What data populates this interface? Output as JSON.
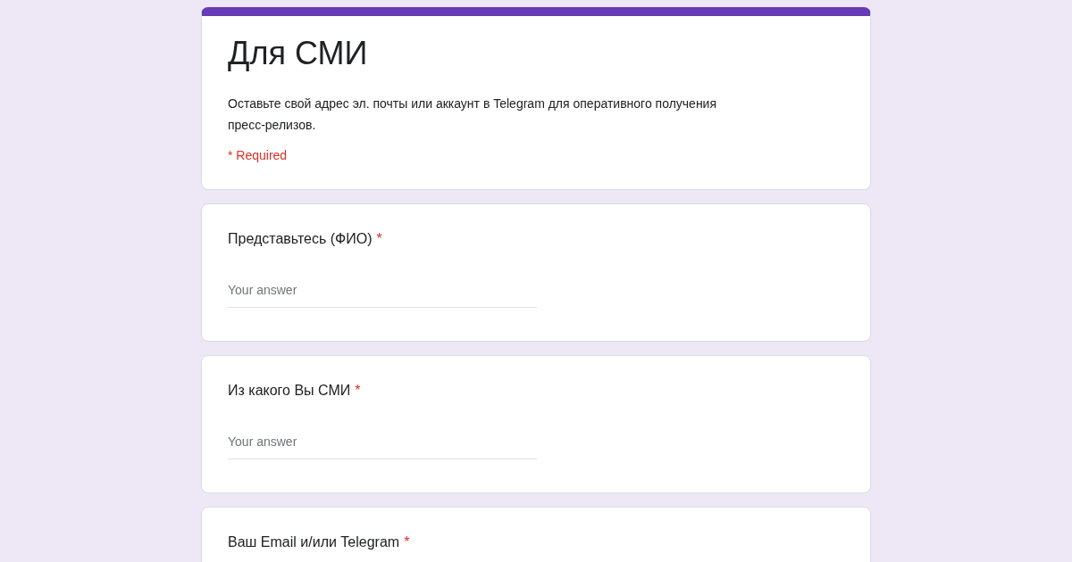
{
  "form": {
    "title": "Для СМИ",
    "description": "Оставьте свой адрес эл. почты или аккаунт в Telegram для оперативного получения пресс-релизов.",
    "required_note": "* Required"
  },
  "questions": [
    {
      "label": "Представьтесь (ФИО)",
      "required_mark": "*",
      "placeholder": "Your answer"
    },
    {
      "label": "Из какого Вы СМИ",
      "required_mark": "*",
      "placeholder": "Your answer"
    },
    {
      "label": "Ваш Email и/или Telegram",
      "required_mark": "*"
    }
  ]
}
